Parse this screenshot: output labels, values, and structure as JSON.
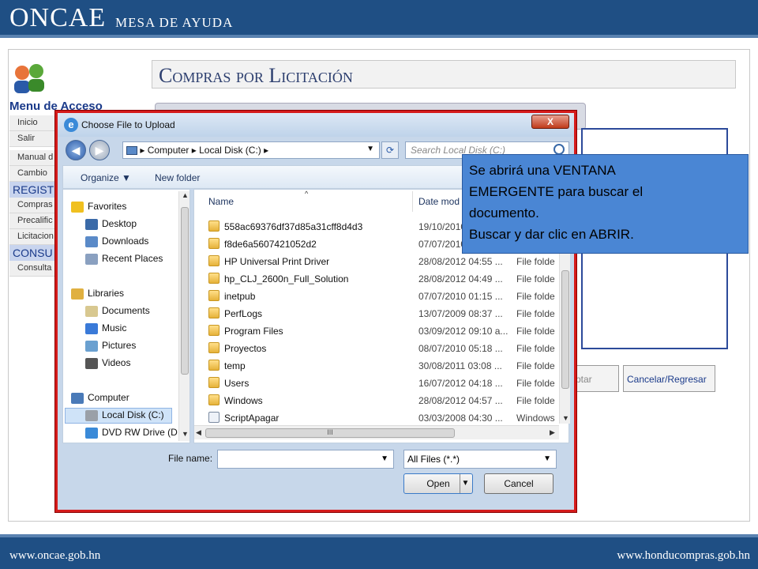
{
  "header": {
    "brand": "ONCAE",
    "subtitle": "MESA DE AYUDA"
  },
  "footer": {
    "left_url": "www.oncae.gob.hn",
    "right_url": "www.honducompras.gob.hn"
  },
  "menu": {
    "title": "Menu de Acceso",
    "items": [
      {
        "label": "Inicio",
        "type": "item"
      },
      {
        "label": "Salir",
        "type": "item"
      },
      {
        "label": "Manual d",
        "type": "item"
      },
      {
        "label": "Cambio",
        "type": "item"
      },
      {
        "label": "REGIST",
        "type": "header"
      },
      {
        "label": "Compras",
        "type": "item"
      },
      {
        "label": "Precalific",
        "type": "item"
      },
      {
        "label": "Licitacion",
        "type": "item"
      },
      {
        "label": "CONSU",
        "type": "header"
      },
      {
        "label": "Consulta",
        "type": "item"
      }
    ]
  },
  "page_title": "Compras por Licitación",
  "background_buttons": {
    "accept": "ptar",
    "cancel": "Cancelar/Regresar"
  },
  "dialog": {
    "title": "Choose File to Upload",
    "close_label": "X",
    "address": {
      "crumbs": [
        "Computer",
        "Local Disk (C:)"
      ]
    },
    "search_placeholder": "Search Local Disk (C:)",
    "toolbar": {
      "organize": "Organize ▼",
      "new_folder": "New folder"
    },
    "nav_tree": [
      {
        "label": "Favorites",
        "icon": "star-icon",
        "level": 0
      },
      {
        "label": "Desktop",
        "icon": "desktop-icon",
        "level": 1
      },
      {
        "label": "Downloads",
        "icon": "downloads-icon",
        "level": 1
      },
      {
        "label": "Recent Places",
        "icon": "recent-places-icon",
        "level": 1
      },
      {
        "label": "Libraries",
        "icon": "library-icon",
        "level": 0
      },
      {
        "label": "Documents",
        "icon": "documents-icon",
        "level": 1
      },
      {
        "label": "Music",
        "icon": "music-icon",
        "level": 1
      },
      {
        "label": "Pictures",
        "icon": "pictures-icon",
        "level": 1
      },
      {
        "label": "Videos",
        "icon": "videos-icon",
        "level": 1
      },
      {
        "label": "Computer",
        "icon": "computer-icon",
        "level": 0
      },
      {
        "label": "Local Disk (C:)",
        "icon": "disk-icon",
        "level": 1,
        "selected": true
      },
      {
        "label": "DVD RW Drive (D",
        "icon": "dvd-icon",
        "level": 1
      }
    ],
    "columns": {
      "name": "Name",
      "date": "Date mod"
    },
    "files": [
      {
        "name": "558ac69376df37d85a31cff8d4d3",
        "date": "19/10/2010",
        "type": ""
      },
      {
        "name": "f8de6a5607421052d2",
        "date": "07/07/2010",
        "type": ""
      },
      {
        "name": "HP Universal Print Driver",
        "date": "28/08/2012 04:55 ...",
        "type": "File folde"
      },
      {
        "name": "hp_CLJ_2600n_Full_Solution",
        "date": "28/08/2012 04:49 ...",
        "type": "File folde"
      },
      {
        "name": "inetpub",
        "date": "07/07/2010 01:15 ...",
        "type": "File folde"
      },
      {
        "name": "PerfLogs",
        "date": "13/07/2009 08:37 ...",
        "type": "File folde"
      },
      {
        "name": "Program Files",
        "date": "03/09/2012 09:10 a...",
        "type": "File folde"
      },
      {
        "name": "Proyectos",
        "date": "08/07/2010 05:18 ...",
        "type": "File folde"
      },
      {
        "name": "temp",
        "date": "30/08/2011 03:08 ...",
        "type": "File folde"
      },
      {
        "name": "Users",
        "date": "16/07/2012 04:18 ...",
        "type": "File folde"
      },
      {
        "name": "Windows",
        "date": "28/08/2012 04:57 ...",
        "type": "File folde"
      },
      {
        "name": "ScriptApagar",
        "date": "03/03/2008 04:30 ...",
        "type": "Windows"
      }
    ],
    "filename_label": "File name:",
    "filename_value": "",
    "filetype": "All Files (*.*)",
    "open_label": "Open",
    "cancel_label": "Cancel"
  },
  "callout": {
    "lines": [
      "Se abrirá una VENTANA",
      "EMERGENTE para buscar el",
      "documento.",
      "Buscar y dar clic en ABRIR."
    ]
  }
}
